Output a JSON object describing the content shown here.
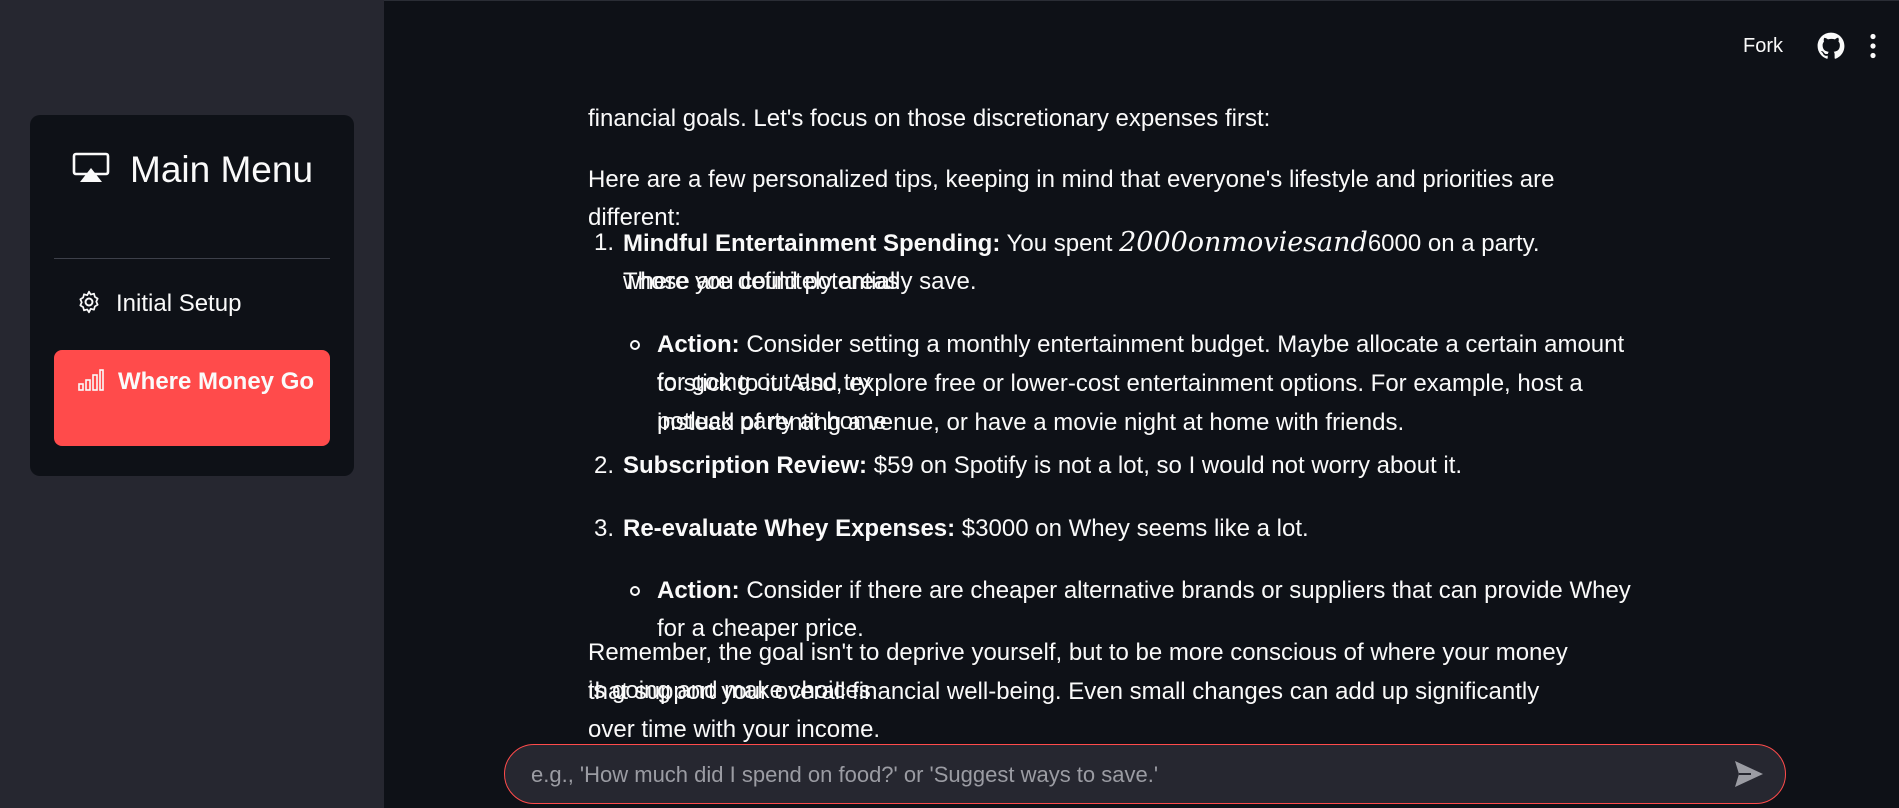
{
  "sidebar": {
    "title": "Main Menu",
    "title_icon": "airplay-icon",
    "items": [
      {
        "label": "Initial Setup",
        "icon": "gear-icon",
        "active": false
      },
      {
        "label": "Where Money Go",
        "icon": "bar-chart-icon",
        "active": true
      }
    ]
  },
  "header": {
    "fork_label": "Fork",
    "github_icon": "github-icon",
    "menu_icon": "kebab-menu-icon"
  },
  "message": {
    "partial_top": "financial goals. Let's focus on those discretionary expenses first:",
    "intro": "Here are a few personalized tips, keeping in mind that everyone's lifestyle and priorities are different:",
    "tips": [
      {
        "number": "1.",
        "heading": "Mindful Entertainment Spending:",
        "text_before": " You spent ",
        "math": "2000onmoviesand",
        "text_after": "6000 on a party. Those are definitely areas",
        "text_line2": "where you could potentially save.",
        "action_label": "Action:",
        "action_text_1": " Consider setting a monthly entertainment budget. Maybe allocate a certain amount for going out and try",
        "action_text_2": "to stick to it. Also, explore free or lower-cost entertainment options. For example, host a potluck party at home",
        "action_text_3": "instead of renting a venue, or have a movie night at home with friends."
      },
      {
        "number": "2.",
        "heading": "Subscription Review:",
        "text": " $59 on Spotify is not a lot, so I would not worry about it."
      },
      {
        "number": "3.",
        "heading": "Re-evaluate Whey Expenses:",
        "text": " $3000 on Whey seems like a lot.",
        "action_label": "Action:",
        "action_text": " Consider if there are cheaper alternative brands or suppliers that can provide Whey for a cheaper price."
      }
    ],
    "closing_1": "Remember, the goal isn't to deprive yourself, but to be more conscious of where your money is going and make choices",
    "closing_2": "that support your overall financial well-being. Even small changes can add up significantly over time with your income."
  },
  "chat": {
    "placeholder": "e.g., 'How much did I spend on food?' or 'Suggest ways to save.'",
    "value": "",
    "send_icon": "send-icon"
  },
  "colors": {
    "sidebar_bg": "#262730",
    "main_bg": "#0e1117",
    "accent": "#ff4b4b",
    "text": "#fafafa"
  }
}
